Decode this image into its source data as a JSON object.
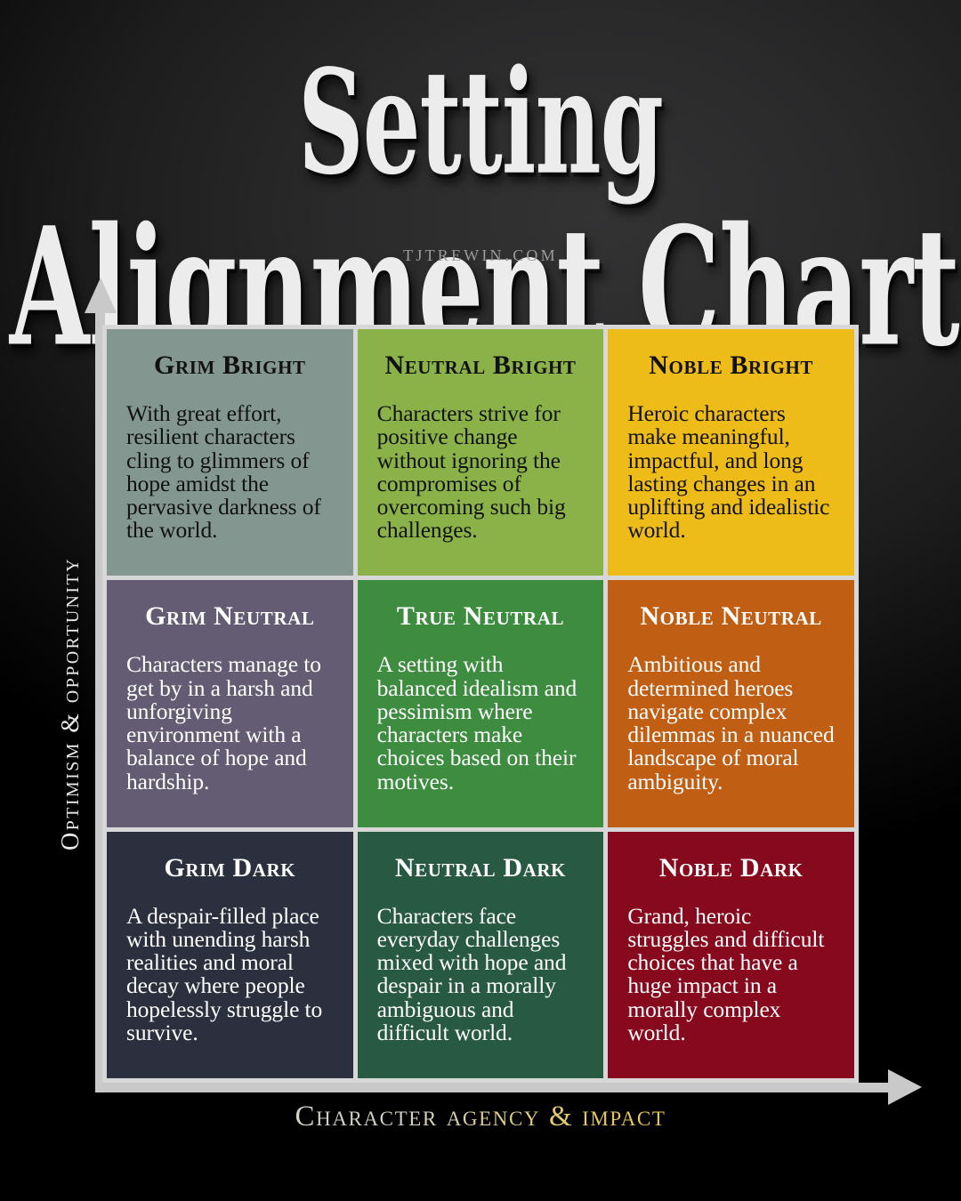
{
  "header": {
    "title_line_1": "Setting",
    "title_line_2": "Alignment Chart",
    "subtitle": "TJTREWIN.COM"
  },
  "axes": {
    "y_label": "Optimism & opportunity",
    "x_label": "Character agency & impact",
    "y_arrow_icon": "arrow-up-icon",
    "x_arrow_icon": "arrow-right-icon",
    "axis_color": "#c9c9c9",
    "x_label_gradient": [
      "#c9c9c9",
      "#f2c72e"
    ]
  },
  "chart_data": {
    "type": "table",
    "title": "Setting Alignment Chart",
    "xlabel": "Character agency & impact",
    "ylabel": "Optimism & opportunity",
    "columns": [
      "Grim",
      "Neutral",
      "Noble"
    ],
    "rows": [
      "Bright",
      "Neutral",
      "Dark"
    ],
    "grid_border_color": "#d7d7d7",
    "cells": [
      {
        "row": "Bright",
        "column": "Grim",
        "title": "Grim Bright",
        "body": "With great effort, resilient characters cling to glimmers of hope amidst the pervasive darkness of the world.",
        "bg": "#839790",
        "fg": "#111111"
      },
      {
        "row": "Bright",
        "column": "Neutral",
        "title": "Neutral Bright",
        "body": "Characters strive for positive change without ignoring the compromises of overcoming such big challenges.",
        "bg": "#8bb248",
        "fg": "#111111"
      },
      {
        "row": "Bright",
        "column": "Noble",
        "title": "Noble Bright",
        "body": "Heroic characters make meaningful, impactful, and long lasting changes in an uplifting and idealistic world.",
        "bg": "#eebc18",
        "fg": "#111111"
      },
      {
        "row": "Neutral",
        "column": "Grim",
        "title": "Grim Neutral",
        "body": "Characters manage to get by in a harsh and unforgiving environment with a balance of hope and hardship.",
        "bg": "#635c72",
        "fg": "#ffffff"
      },
      {
        "row": "Neutral",
        "column": "Neutral",
        "title": "True Neutral",
        "body": "A setting with balanced idealism and pessimism where characters make choices based on their motives.",
        "bg": "#3d8c3f",
        "fg": "#ffffff"
      },
      {
        "row": "Neutral",
        "column": "Noble",
        "title": "Noble Neutral",
        "body": "Ambitious and determined heroes navigate complex dilemmas in a nuanced landscape of moral ambiguity.",
        "bg": "#c05f14",
        "fg": "#ffffff"
      },
      {
        "row": "Dark",
        "column": "Grim",
        "title": "Grim Dark",
        "body": "A despair-filled place with unending harsh realities and moral decay where people hopelessly struggle to survive.",
        "bg": "#2c303e",
        "fg": "#ffffff"
      },
      {
        "row": "Dark",
        "column": "Neutral",
        "title": "Neutral Dark",
        "body": "Characters face everyday challenges mixed with hope and despair in a morally ambiguous and difficult world.",
        "bg": "#275943",
        "fg": "#ffffff"
      },
      {
        "row": "Dark",
        "column": "Noble",
        "title": "Noble Dark",
        "body": "Grand, heroic struggles and difficult choices that have a huge impact in a morally complex world.",
        "bg": "#86091e",
        "fg": "#ffffff"
      }
    ]
  }
}
